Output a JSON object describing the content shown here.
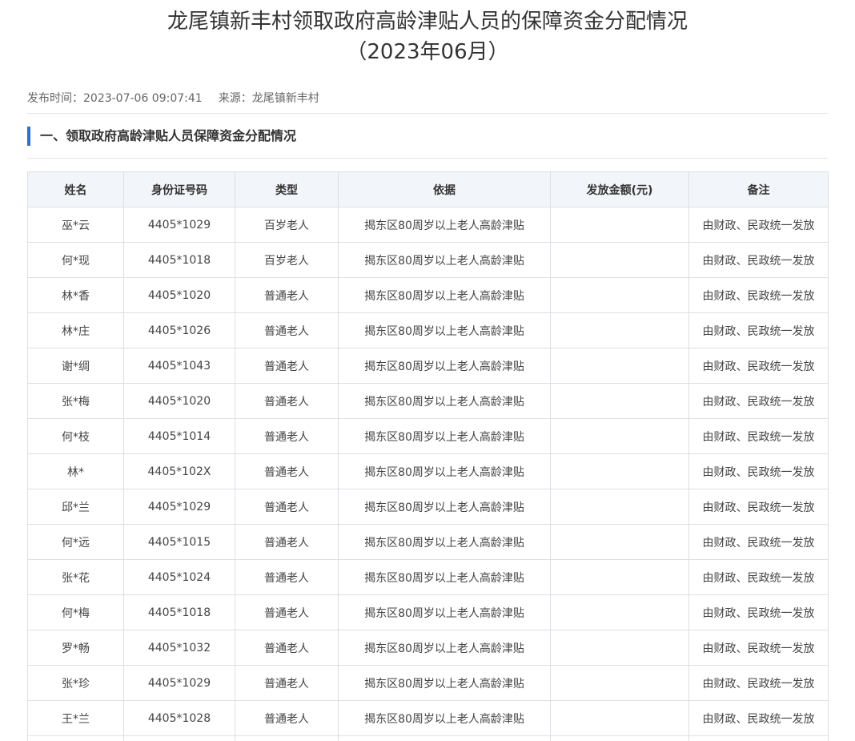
{
  "article": {
    "title_line1": "龙尾镇新丰村领取政府高龄津贴人员的保障资金分配情况",
    "title_line2": "（2023年06月）",
    "publish_label": "发布时间：",
    "publish_time": "2023-07-06 09:07:41",
    "source_label": "来源：",
    "source": "龙尾镇新丰村"
  },
  "section": {
    "heading": "一、领取政府高龄津贴人员保障资金分配情况",
    "accent_color": "#2a6fdb"
  },
  "table": {
    "headers": [
      "姓名",
      "身份证号码",
      "类型",
      "依据",
      "发放金额(元)",
      "备注"
    ],
    "rows": [
      [
        "巫*云",
        "4405*1029",
        "百岁老人",
        "揭东区80周岁以上老人高龄津贴",
        "",
        "由财政、民政统一发放"
      ],
      [
        "何*现",
        "4405*1018",
        "百岁老人",
        "揭东区80周岁以上老人高龄津贴",
        "",
        "由财政、民政统一发放"
      ],
      [
        "林*香",
        "4405*1020",
        "普通老人",
        "揭东区80周岁以上老人高龄津贴",
        "",
        "由财政、民政统一发放"
      ],
      [
        "林*庄",
        "4405*1026",
        "普通老人",
        "揭东区80周岁以上老人高龄津贴",
        "",
        "由财政、民政统一发放"
      ],
      [
        "谢*绸",
        "4405*1043",
        "普通老人",
        "揭东区80周岁以上老人高龄津贴",
        "",
        "由财政、民政统一发放"
      ],
      [
        "张*梅",
        "4405*1020",
        "普通老人",
        "揭东区80周岁以上老人高龄津贴",
        "",
        "由财政、民政统一发放"
      ],
      [
        "何*枝",
        "4405*1014",
        "普通老人",
        "揭东区80周岁以上老人高龄津贴",
        "",
        "由财政、民政统一发放"
      ],
      [
        "林*",
        "4405*102X",
        "普通老人",
        "揭东区80周岁以上老人高龄津贴",
        "",
        "由财政、民政统一发放"
      ],
      [
        "邱*兰",
        "4405*1029",
        "普通老人",
        "揭东区80周岁以上老人高龄津贴",
        "",
        "由财政、民政统一发放"
      ],
      [
        "何*远",
        "4405*1015",
        "普通老人",
        "揭东区80周岁以上老人高龄津贴",
        "",
        "由财政、民政统一发放"
      ],
      [
        "张*花",
        "4405*1024",
        "普通老人",
        "揭东区80周岁以上老人高龄津贴",
        "",
        "由财政、民政统一发放"
      ],
      [
        "何*梅",
        "4405*1018",
        "普通老人",
        "揭东区80周岁以上老人高龄津贴",
        "",
        "由财政、民政统一发放"
      ],
      [
        "罗*畅",
        "4405*1032",
        "普通老人",
        "揭东区80周岁以上老人高龄津贴",
        "",
        "由财政、民政统一发放"
      ],
      [
        "张*珍",
        "4405*1029",
        "普通老人",
        "揭东区80周岁以上老人高龄津贴",
        "",
        "由财政、民政统一发放"
      ],
      [
        "王*兰",
        "4405*1028",
        "普通老人",
        "揭东区80周岁以上老人高龄津贴",
        "",
        "由财政、民政统一发放"
      ],
      [
        "",
        "",
        "",
        "",
        "",
        ""
      ]
    ]
  }
}
